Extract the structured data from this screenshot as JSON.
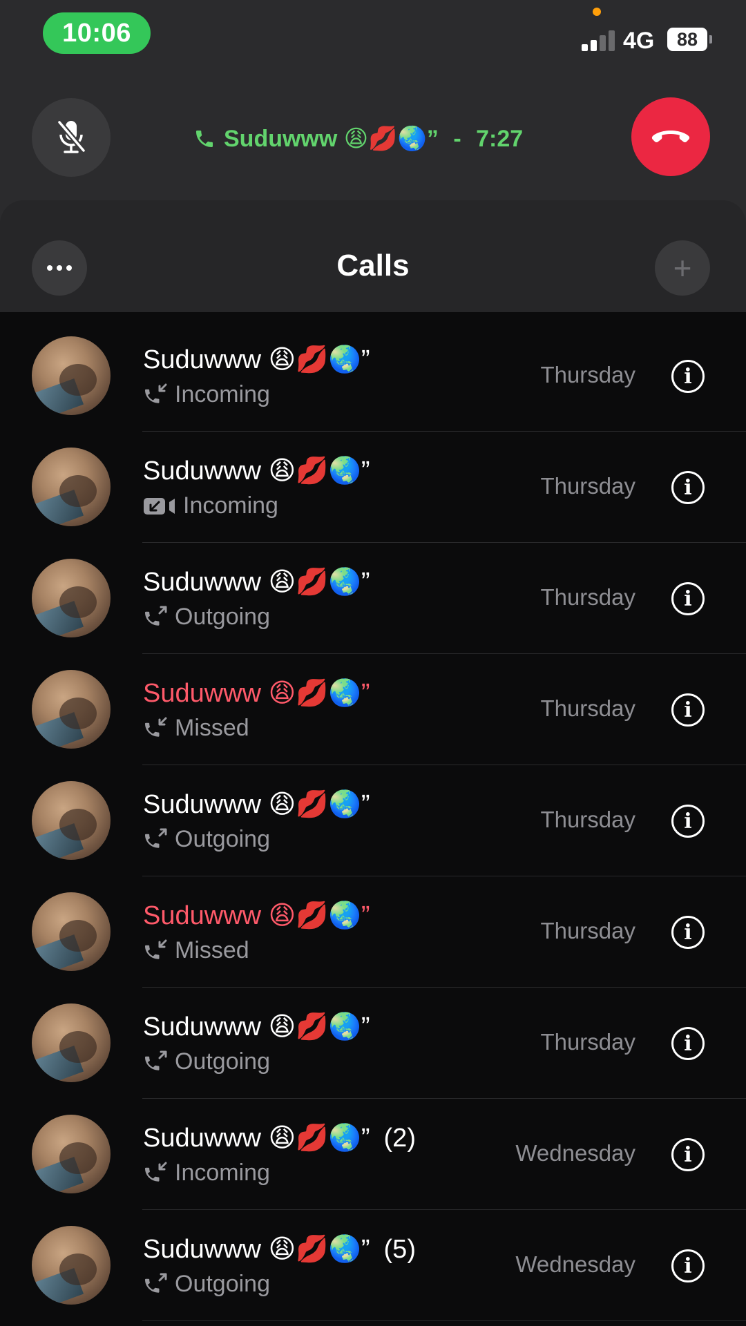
{
  "status_bar": {
    "time": "10:06",
    "network": "4G",
    "battery": "88",
    "signal_bars_active": 2,
    "signal_bars_total": 4
  },
  "ongoing_call": {
    "contact": "Suduwww 😩💋🌏”",
    "separator": " - ",
    "duration": "7:27"
  },
  "header": {
    "title": "Calls"
  },
  "calls": [
    {
      "name": "Suduwww 😩💋🌏”",
      "count": "",
      "type": "Incoming",
      "kind": "voice-in",
      "missed": false,
      "day": "Thursday"
    },
    {
      "name": "Suduwww 😩💋🌏”",
      "count": "",
      "type": "Incoming",
      "kind": "video-in",
      "missed": false,
      "day": "Thursday"
    },
    {
      "name": "Suduwww 😩💋🌏”",
      "count": "",
      "type": "Outgoing",
      "kind": "voice-out",
      "missed": false,
      "day": "Thursday"
    },
    {
      "name": "Suduwww 😩💋🌏”",
      "count": "",
      "type": "Missed",
      "kind": "voice-in",
      "missed": true,
      "day": "Thursday"
    },
    {
      "name": "Suduwww 😩💋🌏”",
      "count": "",
      "type": "Outgoing",
      "kind": "voice-out",
      "missed": false,
      "day": "Thursday"
    },
    {
      "name": "Suduwww 😩💋🌏”",
      "count": "",
      "type": "Missed",
      "kind": "voice-in",
      "missed": true,
      "day": "Thursday"
    },
    {
      "name": "Suduwww 😩💋🌏”",
      "count": "",
      "type": "Outgoing",
      "kind": "voice-out",
      "missed": false,
      "day": "Thursday"
    },
    {
      "name": "Suduwww 😩💋🌏”",
      "count": "(2)",
      "type": "Incoming",
      "kind": "voice-in",
      "missed": false,
      "day": "Wednesday"
    },
    {
      "name": "Suduwww 😩💋🌏”",
      "count": "(5)",
      "type": "Outgoing",
      "kind": "voice-out",
      "missed": false,
      "day": "Wednesday"
    }
  ],
  "icons": {
    "mute": "mic-off-icon",
    "end_call": "phone-down-icon",
    "more": "ellipsis-icon",
    "add": "plus-icon",
    "info": "info-icon"
  },
  "colors": {
    "accent_green": "#34c759",
    "end_call_red": "#eb2742",
    "missed_red": "#ff5a6a"
  }
}
